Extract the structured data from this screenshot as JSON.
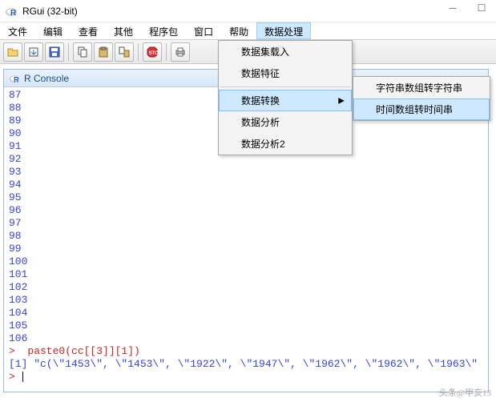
{
  "title": "RGui (32-bit)",
  "menubar": [
    "文件",
    "编辑",
    "查看",
    "其他",
    "程序包",
    "窗口",
    "帮助",
    "数据处理"
  ],
  "menubar_open_index": 7,
  "toolbar_icons": [
    "open-icon",
    "load-icon",
    "save-icon",
    "copy-icon",
    "paste-icon",
    "copy2-icon",
    "stop-icon",
    "print-icon"
  ],
  "console": {
    "title": "R Console",
    "lines": [
      "87",
      "88",
      "89",
      "90",
      "91",
      "92",
      "93",
      "94",
      "95",
      "96",
      "97",
      "98",
      "99",
      "100",
      "101",
      "102",
      "103",
      "104",
      "105",
      "106"
    ],
    "prompt1": ">  paste0(cc[[3]][1])",
    "output1": "[1] \"c(\\\"1453\\\", \\\"1453\\\", \\\"1922\\\", \\\"1947\\\", \\\"1962\\\", \\\"1962\\\", \\\"1963\\\"",
    "prompt2": "> "
  },
  "dropdown1": {
    "items": [
      {
        "label": "数据集载入",
        "hl": false,
        "arrow": false
      },
      {
        "label": "数据特征",
        "hl": false,
        "arrow": false
      },
      {
        "sep": true
      },
      {
        "label": "数据转换",
        "hl": true,
        "arrow": true
      },
      {
        "label": "数据分析",
        "hl": false,
        "arrow": false
      },
      {
        "label": "数据分析2",
        "hl": false,
        "arrow": false
      }
    ]
  },
  "dropdown2": {
    "items": [
      {
        "label": "字符串数组转字符串",
        "hl": false
      },
      {
        "label": "时间数组转时间串",
        "hl": true
      }
    ]
  },
  "watermark": "头条@甲亥13"
}
